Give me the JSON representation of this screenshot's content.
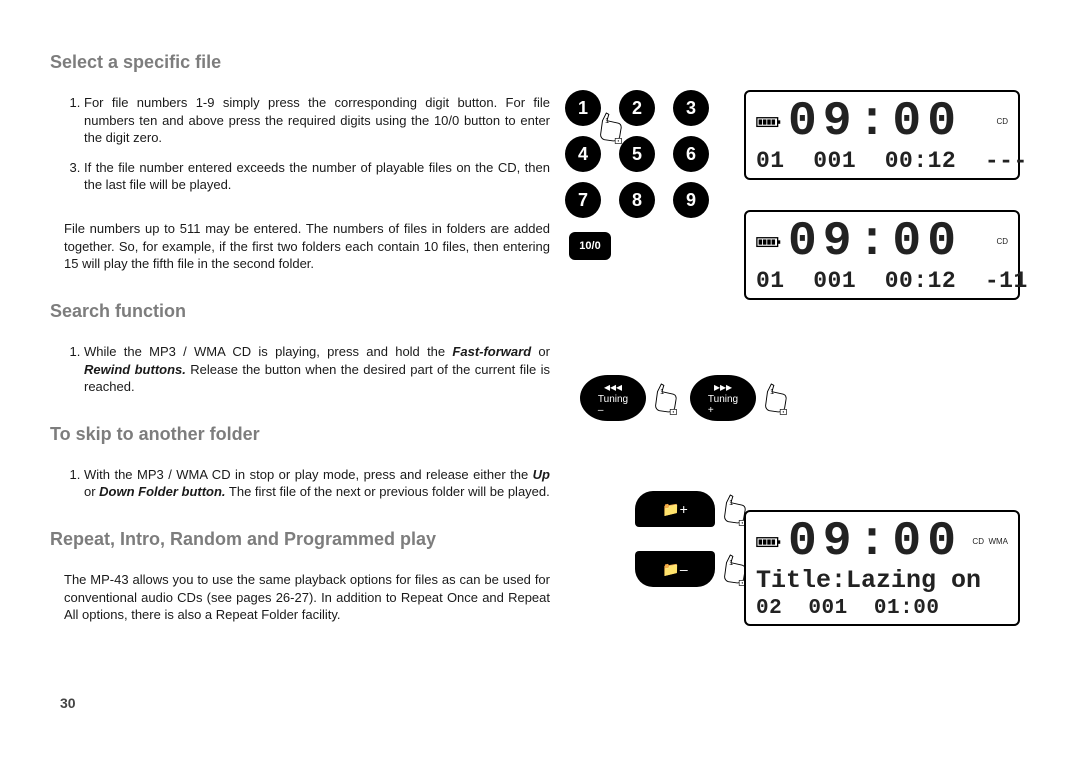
{
  "page_number": "30",
  "headings": {
    "select_file": "Select a specific file",
    "search_fn": "Search function",
    "skip_folder": "To skip to another folder",
    "repeat": "Repeat, Intro, Random and Programmed play"
  },
  "select_file_steps": [
    "For file numbers 1-9 simply press the corresponding digit button. For file numbers ten and above press the required digits using the 10/0 button to enter the digit zero.",
    "If the file number entered exceeds the number of playable files on the CD, then the last file will be played."
  ],
  "select_file_note": "File numbers up to 511 may be entered. The numbers of files in folders are added together. So, for example, if the first two folders each contain 10 files, then entering 15 will play the fifth file in the second folder.",
  "search_fn_steps_prefix": "While the MP3 / WMA CD is playing, press and hold the ",
  "search_fn_bold1": "Fast-forward",
  "search_fn_mid": " or ",
  "search_fn_bold2": "Rewind buttons.",
  "search_fn_suffix": "  Release the button when the desired part of the current file is reached.",
  "skip_folder_prefix": "With the MP3 / WMA CD in stop or play mode, press and release either the ",
  "skip_folder_bold1": "Up",
  "skip_folder_mid": " or ",
  "skip_folder_bold2": "Down Folder button.",
  "skip_folder_suffix": "  The first file of the next or previous folder will be played.",
  "repeat_para": "The MP-43 allows you to use the same playback options for files as can be used for conventional audio CDs (see pages 26-27). In addition to Repeat Once and Repeat All options, there is also a Repeat Folder facility.",
  "keypad": {
    "k1": "1",
    "k2": "2",
    "k3": "3",
    "k4": "4",
    "k5": "5",
    "k6": "6",
    "k7": "7",
    "k8": "8",
    "k9": "9",
    "k10": "10/0"
  },
  "buttons": {
    "rw_sym": "◂◂◂",
    "ff_sym": "▸▸▸",
    "tuning_minus": "Tuning",
    "minus": "–",
    "tuning_plus": "Tuning",
    "plus": "+",
    "folder_up_icon": "📁+",
    "folder_dn_icon": "📁–",
    "hand_label": "1"
  },
  "lcd1": {
    "time": "09:00",
    "tag_cd": "CD",
    "bottom": "01  001  00:12  ---"
  },
  "lcd2": {
    "time": "09:00",
    "tag_cd": "CD",
    "bottom": "01  001  00:12  -11"
  },
  "lcd3": {
    "time": "09:00",
    "tag_cd": "CD",
    "tag_wma": "WMA",
    "title_line": "Title:Lazing on",
    "bottom": "02  001  01:00"
  }
}
